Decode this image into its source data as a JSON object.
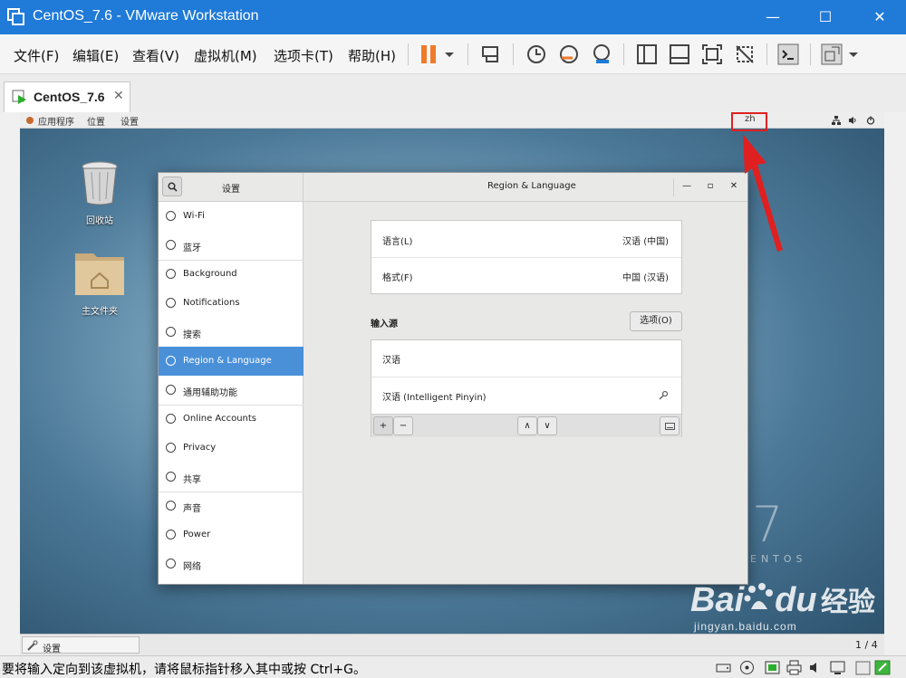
{
  "window": {
    "title": "CentOS_7.6 - VMware Workstation",
    "minimize": "—",
    "maximize": "☐",
    "close": "✕"
  },
  "menu": [
    "文件(F)",
    "编辑(E)",
    "查看(V)",
    "虚拟机(M)",
    "选项卡(T)",
    "帮助(H)"
  ],
  "tab": {
    "label": "CentOS_7.6",
    "close": "✕"
  },
  "guest_topbar": {
    "apps": "应用程序",
    "places": "位置",
    "settings": "设置",
    "input_indicator": "zh"
  },
  "desktop_icons": [
    {
      "label": "回收站"
    },
    {
      "label": "主文件夹"
    }
  ],
  "settings": {
    "side_title": "设置",
    "main_title": "Region & Language",
    "controls": {
      "min": "—",
      "max": "▫",
      "close": "✕"
    },
    "sidebar": [
      {
        "label": "Wi-Fi",
        "icon": "wifi-icon"
      },
      {
        "label": "蓝牙",
        "icon": "bluetooth-icon"
      },
      {
        "label": "Background",
        "icon": "background-icon"
      },
      {
        "label": "Notifications",
        "icon": "bell-icon"
      },
      {
        "label": "搜索",
        "icon": "search-icon"
      },
      {
        "label": "Region & Language",
        "icon": "region-icon",
        "active": true
      },
      {
        "label": "通用辅助功能",
        "icon": "accessibility-icon"
      },
      {
        "label": "Online Accounts",
        "icon": "online-accounts-icon"
      },
      {
        "label": "Privacy",
        "icon": "privacy-icon"
      },
      {
        "label": "共享",
        "icon": "share-icon"
      },
      {
        "label": "声音",
        "icon": "sound-icon"
      },
      {
        "label": "Power",
        "icon": "power-icon"
      },
      {
        "label": "网络",
        "icon": "network-icon"
      }
    ],
    "language": {
      "label": "语言(L)",
      "value": "汉语 (中国)"
    },
    "formats": {
      "label": "格式(F)",
      "value": "中国 (汉语)"
    },
    "input_sources": {
      "heading": "输入源",
      "options_button": "选项(O)",
      "items": [
        "汉语",
        "汉语 (Intelligent Pinyin)"
      ],
      "add": "+",
      "remove": "−",
      "up": "∧",
      "down": "∨"
    }
  },
  "guest_bottombar": {
    "task": "设置",
    "page": "1 / 4"
  },
  "watermark": {
    "brand": "Bai",
    "brand2": "du",
    "cn": "经验",
    "url": "jingyan.baidu.com"
  },
  "centos_brand": "ENTOS",
  "centos_num": "7",
  "statusbar": {
    "message": "要将输入定向到该虚拟机，请将鼠标指针移入其中或按 Ctrl+G。"
  },
  "colors": {
    "titlebar": "#1f7ad8",
    "active": "#4a90d9",
    "pause": "#f07a2a",
    "highlight": "#e02020"
  }
}
